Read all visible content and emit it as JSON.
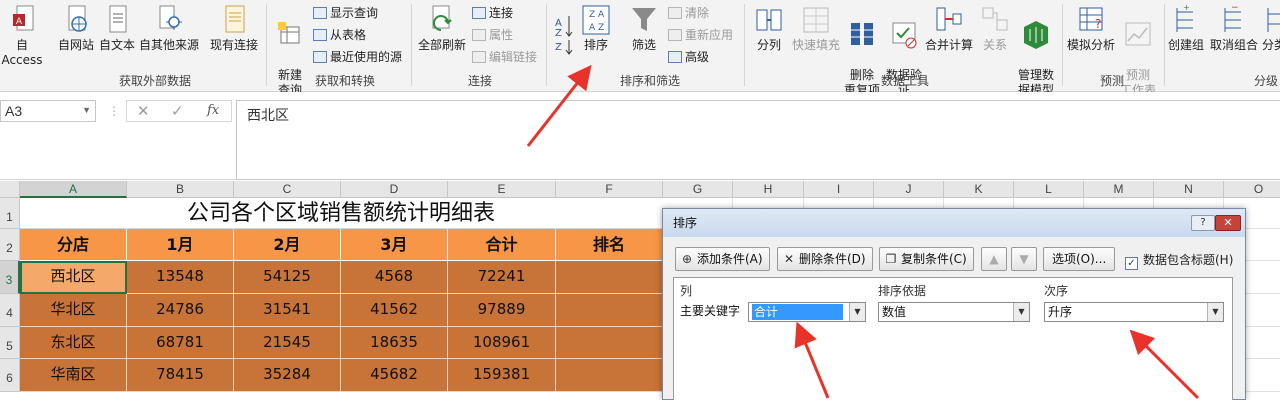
{
  "ribbon": {
    "groups": {
      "external": "获取外部数据",
      "transform": "获取和转换",
      "connections": "连接",
      "sortfilter": "排序和筛选",
      "datatools": "数据工具",
      "forecast": "预测",
      "outline": "分级"
    },
    "buttons": {
      "access": "自 Access",
      "web": "自网站",
      "text": "自文本",
      "other": "自其他来源",
      "existing": "现有连接",
      "newquery": "新建\n查询",
      "showquery": "显示查询",
      "fromtable": "从表格",
      "recent": "最近使用的源",
      "refreshall": "全部刷新",
      "conn": "连接",
      "props": "属性",
      "editlinks": "编辑链接",
      "sort": "排序",
      "filter": "筛选",
      "clear": "清除",
      "reapply": "重新应用",
      "advanced": "高级",
      "split": "分列",
      "flashfill": "快速填充",
      "removedup": "删除\n重复项",
      "validation": "数据验\n证",
      "consolidate": "合并计算",
      "relations": "关系",
      "datamodel": "管理数\n据模型",
      "whatif": "模拟分析",
      "forecastsheet": "预测\n工作表",
      "group": "创建组",
      "ungroup": "取消组合",
      "subtotal": "分类"
    }
  },
  "formula_bar": {
    "name_box": "A3",
    "fx": "fx",
    "content": "西北区"
  },
  "sheet": {
    "columns": [
      "A",
      "B",
      "C",
      "D",
      "E",
      "F",
      "G",
      "H",
      "I",
      "J",
      "K",
      "L",
      "M",
      "N",
      "O"
    ],
    "rows": [
      "1",
      "2",
      "3",
      "4",
      "5",
      "6"
    ],
    "title": "公司各个区域销售额统计明细表",
    "headers": [
      "分店",
      "1月",
      "2月",
      "3月",
      "合计",
      "排名"
    ],
    "data": [
      [
        "西北区",
        "13548",
        "54125",
        "4568",
        "72241",
        ""
      ],
      [
        "华北区",
        "24786",
        "31541",
        "41562",
        "97889",
        ""
      ],
      [
        "东北区",
        "68781",
        "21545",
        "18635",
        "108961",
        ""
      ],
      [
        "华南区",
        "78415",
        "35284",
        "45682",
        "159381",
        ""
      ]
    ]
  },
  "sort_dialog": {
    "title": "排序",
    "help": "?",
    "close": "✕",
    "add_level": "添加条件(A)",
    "delete_level": "删除条件(D)",
    "copy_level": "复制条件(C)",
    "options": "选项(O)...",
    "has_headers": "数据包含标题(H)",
    "col_header": "列",
    "sorton_header": "排序依据",
    "order_header": "次序",
    "sort_by_label": "主要关键字",
    "sort_by_value": "合计",
    "sort_on_value": "数值",
    "order_value": "升序"
  },
  "colors": {
    "header_fill": "#f79646",
    "data_fill": "#c87337",
    "arrow": "#e8332a",
    "excel_green": "#217346"
  }
}
